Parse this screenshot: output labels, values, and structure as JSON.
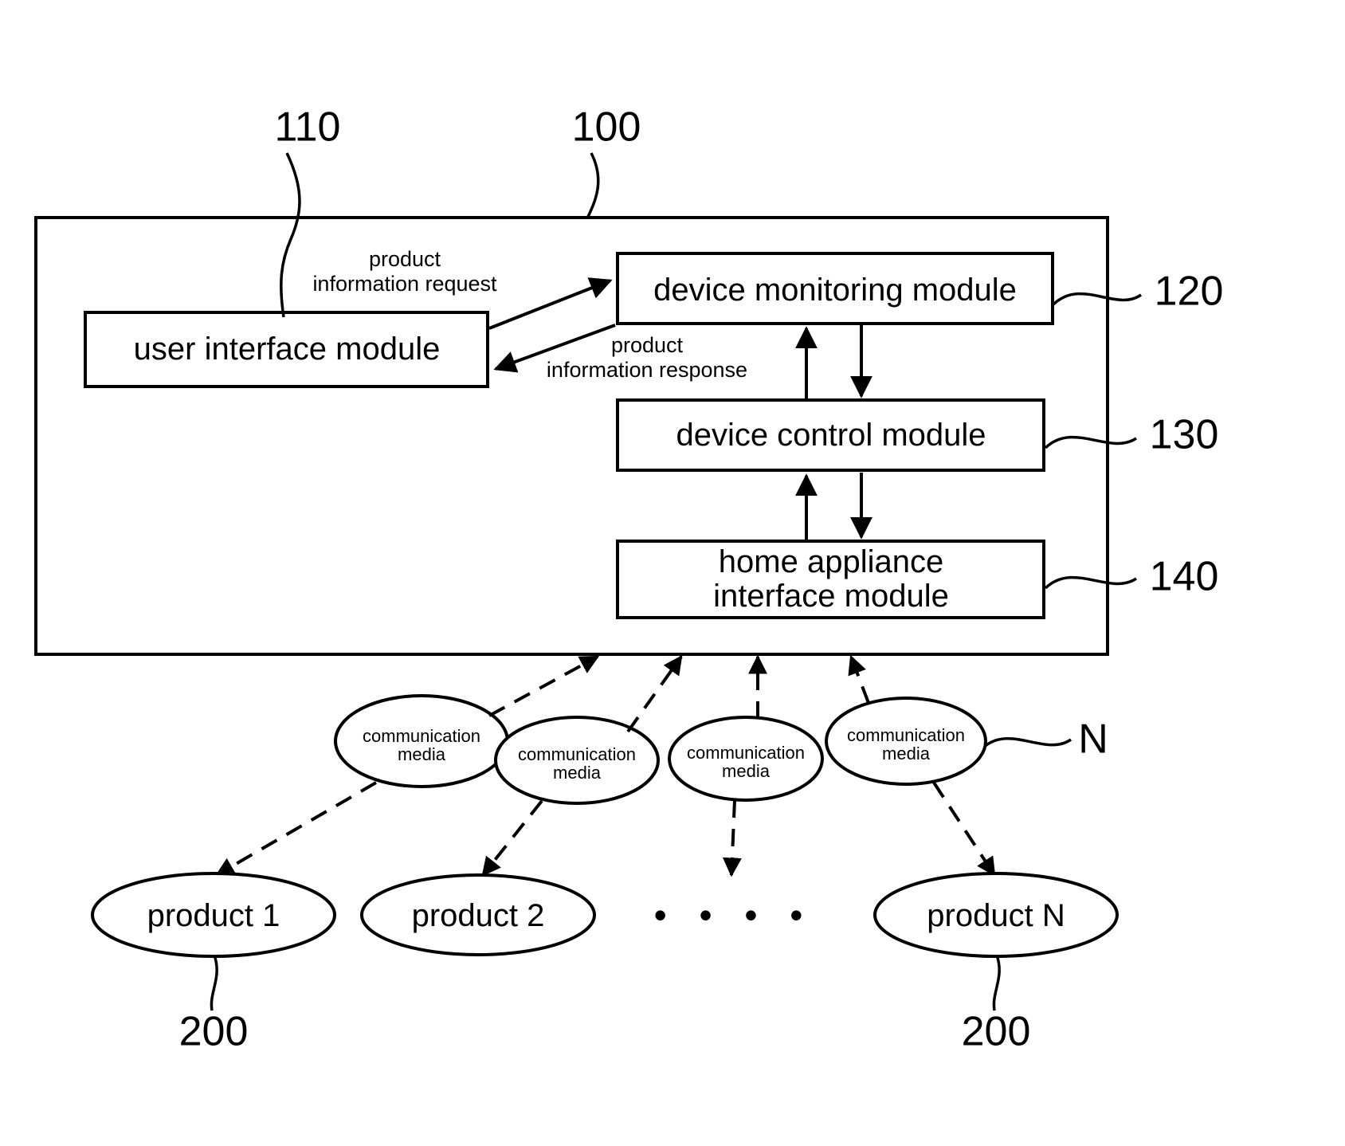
{
  "figure": {
    "system_box_ref": "100",
    "modules": [
      {
        "id": "user-interface-module",
        "label": "user interface module",
        "ref": "110"
      },
      {
        "id": "device-monitoring-module",
        "label": "device monitoring module",
        "ref": "120"
      },
      {
        "id": "device-control-module",
        "label": "device control module",
        "ref": "130"
      },
      {
        "id": "home-appliance-interface-module",
        "label_line1": "home appliance",
        "label_line2": "interface module",
        "ref": "140"
      }
    ],
    "flows": [
      {
        "id": "product-information-request",
        "line1": "product",
        "line2": "information request"
      },
      {
        "id": "product-information-response",
        "line1": "product",
        "line2": "information response"
      }
    ],
    "communication_media": [
      {
        "line1": "communication",
        "line2": "media"
      },
      {
        "line1": "communication",
        "line2": "media"
      },
      {
        "line1": "communication",
        "line2": "media"
      },
      {
        "line1": "communication",
        "line2": "media"
      }
    ],
    "communication_media_ref": "N",
    "products": [
      {
        "label": "product 1",
        "ref": "200"
      },
      {
        "label": "product 2",
        "ref": ""
      },
      {
        "label": "product N",
        "ref": "200"
      }
    ],
    "ellipsis_dots": "• • • •",
    "colors": {
      "ink": "#000000",
      "paper": "#ffffff"
    }
  }
}
